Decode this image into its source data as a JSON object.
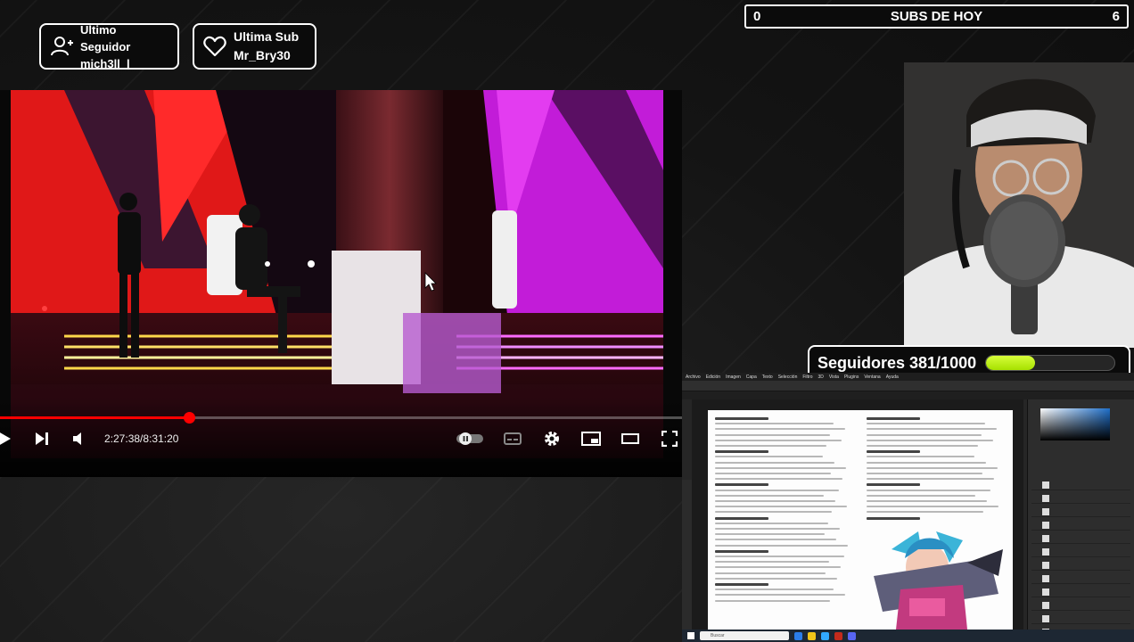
{
  "overlay": {
    "last_follower_title": "Ultimo Seguidor",
    "last_follower_name": "mich3ll_l",
    "last_sub_title": "Ultima Sub",
    "last_sub_name": "Mr_Bry30",
    "subs_left": "0",
    "subs_title": "SUBS DE HOY",
    "subs_right": "6",
    "followers_label": "Seguidores 381/1000",
    "followers_current": 381,
    "followers_goal": 1000
  },
  "player": {
    "time_current": "2:27:38",
    "time_total": "8:31:20",
    "time_separator": " / ",
    "progress_fraction": 0.277,
    "icons": [
      "play-icon",
      "next-icon",
      "volume-icon",
      "autoplay-toggle-icon",
      "subtitles-icon",
      "settings-gear-icon",
      "miniplayer-icon",
      "theater-mode-icon",
      "fullscreen-icon"
    ]
  },
  "photoshop": {
    "menu": [
      "Archivo",
      "Edición",
      "Imagen",
      "Capa",
      "Texto",
      "Selección",
      "Filtro",
      "3D",
      "Vista",
      "Plugins",
      "Ventana",
      "Ayuda"
    ],
    "taskbar_search": "Buscar"
  },
  "colors": {
    "progress_red": "#ff0000",
    "goal_green": "#b4ec14",
    "overlay_black": "#0b0b0b"
  }
}
